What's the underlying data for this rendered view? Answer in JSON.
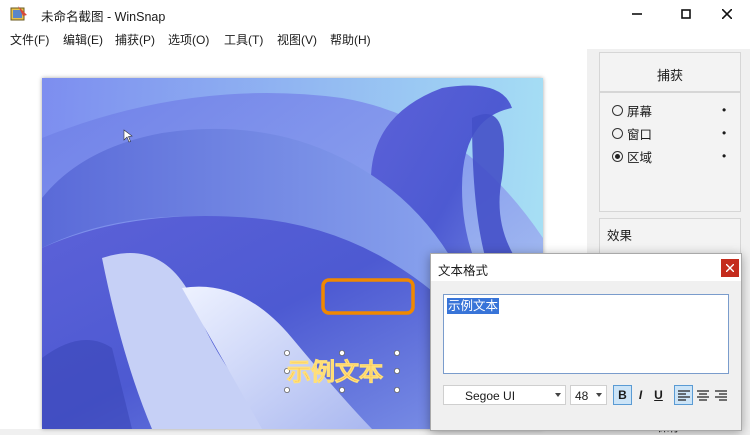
{
  "window": {
    "title": "未命名截图 - WinSnap",
    "icon": "winsnap-app-icon",
    "controls": [
      "minimize-icon",
      "maximize-icon",
      "close-icon"
    ]
  },
  "menu": [
    "文件(F)",
    "编辑(E)",
    "捕获(P)",
    "选项(O)",
    "工具(T)",
    "视图(V)",
    "帮助(H)"
  ],
  "capture_panel": {
    "header": "捕获",
    "options": [
      {
        "label": "屏幕",
        "selected": false,
        "dot": "•"
      },
      {
        "label": "窗口",
        "selected": false,
        "dot": "•"
      },
      {
        "label": "区域",
        "selected": true,
        "dot": "•"
      }
    ],
    "tools": [
      "pointer-icon",
      "timer-icon",
      "refresh-icon"
    ]
  },
  "effects_panel": {
    "header": "效果"
  },
  "save_button": "保存",
  "canvas": {
    "overlay_text": "示例文本",
    "highlight_color": "#f08800"
  },
  "text_dialog": {
    "title": "文本格式",
    "text_value": "示例文本",
    "font": "Segoe UI",
    "size": "48",
    "bold_label": "B",
    "italic_label": "I",
    "underline_label": "U",
    "bold_active": true,
    "align_left_active": true
  },
  "colors": {
    "accent": "#3874d8",
    "close_red": "#c42b1c",
    "orange_text": "#f07c00"
  }
}
